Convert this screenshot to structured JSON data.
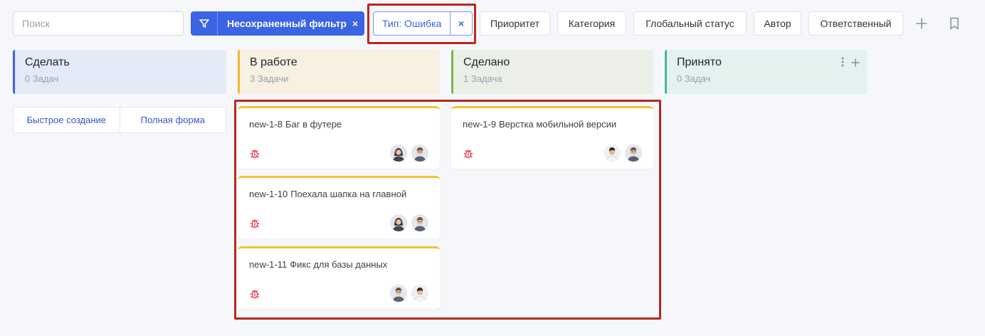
{
  "toolbar": {
    "search_placeholder": "Поиск",
    "filter_label": "Несохраненный фильтр",
    "filter_close": "×",
    "type_chip_label": "Тип: Ошибка",
    "type_chip_close": "×",
    "filters": [
      "Приоритет",
      "Категория",
      "Глобальный статус",
      "Автор",
      "Ответственный"
    ]
  },
  "columns": [
    {
      "title": "Сделать",
      "count": "0 Задач",
      "accent": "#3b63e6",
      "bg": "#e5eaf8"
    },
    {
      "title": "В работе",
      "count": "3 Задачи",
      "accent": "#f1b82d",
      "bg": "#f8f0e0"
    },
    {
      "title": "Сделано",
      "count": "1 Задача",
      "accent": "#7ab648",
      "bg": "#ebefe8"
    },
    {
      "title": "Принято",
      "count": "0 Задач",
      "accent": "#3fbf8f",
      "bg": "#e3f2ee"
    }
  ],
  "quick_create": {
    "quick": "Быстрое создание",
    "full": "Полная форма"
  },
  "cards": [
    {
      "key": "new-1-8",
      "title": "Баг в футере",
      "type_icon": "bug-icon"
    },
    {
      "key": "new-1-10",
      "title": "Поехала шапка на главной",
      "type_icon": "bug-icon"
    },
    {
      "key": "new-1-11",
      "title": "Фикс для базы данных",
      "type_icon": "bug-icon"
    },
    {
      "key": "new-1-9",
      "title": "Верстка мобильной версии",
      "type_icon": "bug-icon"
    }
  ],
  "colors": {
    "primary": "#3b63e6",
    "card_top": "#f1c232",
    "bug": "#e8424f",
    "highlight": "#b8281c"
  }
}
